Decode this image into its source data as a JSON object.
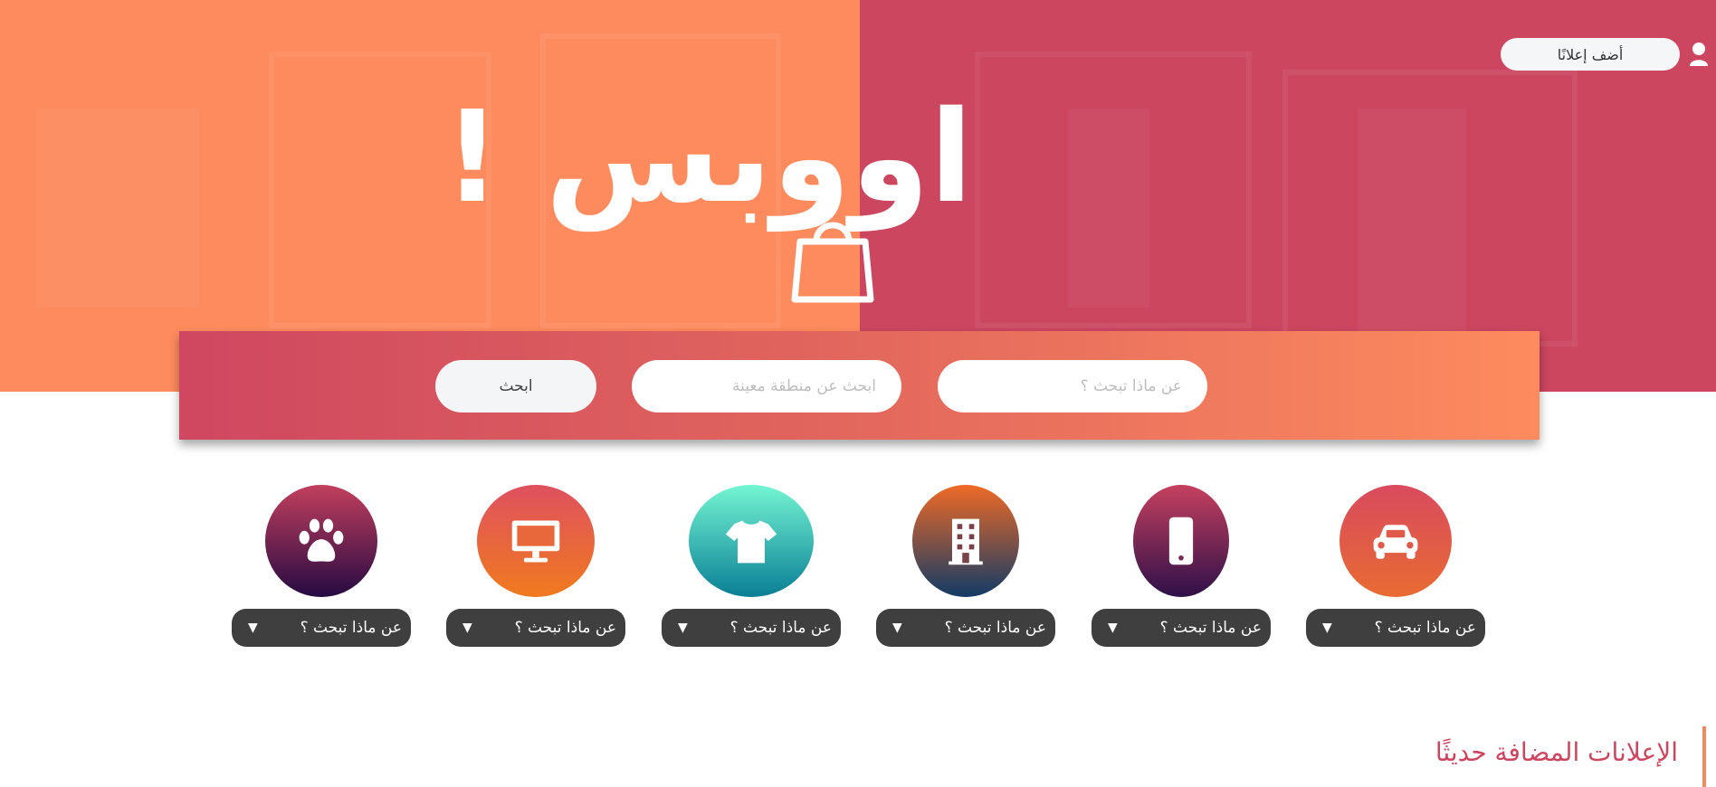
{
  "header": {
    "add_ad_label": "أضف إعلانًا",
    "user_icon": "user-icon"
  },
  "hero": {
    "logo_text": "اووبس !",
    "logo_icon": "shopping-bag-icon",
    "colors": {
      "left": "#fd8b5e",
      "right": "#cc4660"
    }
  },
  "search": {
    "what_placeholder": "عن ماذا تبحث ؟",
    "area_placeholder": "ابحث عن منطقة معينة",
    "button_label": "ابحث"
  },
  "categories": [
    {
      "icon": "car-icon",
      "label": "عن ماذا تبحث ؟",
      "arrow": "▼"
    },
    {
      "icon": "mobile-phone-icon",
      "label": "عن ماذا تبحث ؟",
      "arrow": "▼"
    },
    {
      "icon": "building-icon",
      "label": "عن ماذا تبحث ؟",
      "arrow": "▼"
    },
    {
      "icon": "tshirt-icon",
      "label": "عن ماذا تبحث ؟",
      "arrow": "▼"
    },
    {
      "icon": "desktop-monitor-icon",
      "label": "عن ماذا تبحث ؟",
      "arrow": "▼"
    },
    {
      "icon": "paw-icon",
      "label": "عن ماذا تبحث ؟",
      "arrow": "▼"
    }
  ],
  "recent": {
    "title": "الإعلانات المضافة حديثًا"
  }
}
